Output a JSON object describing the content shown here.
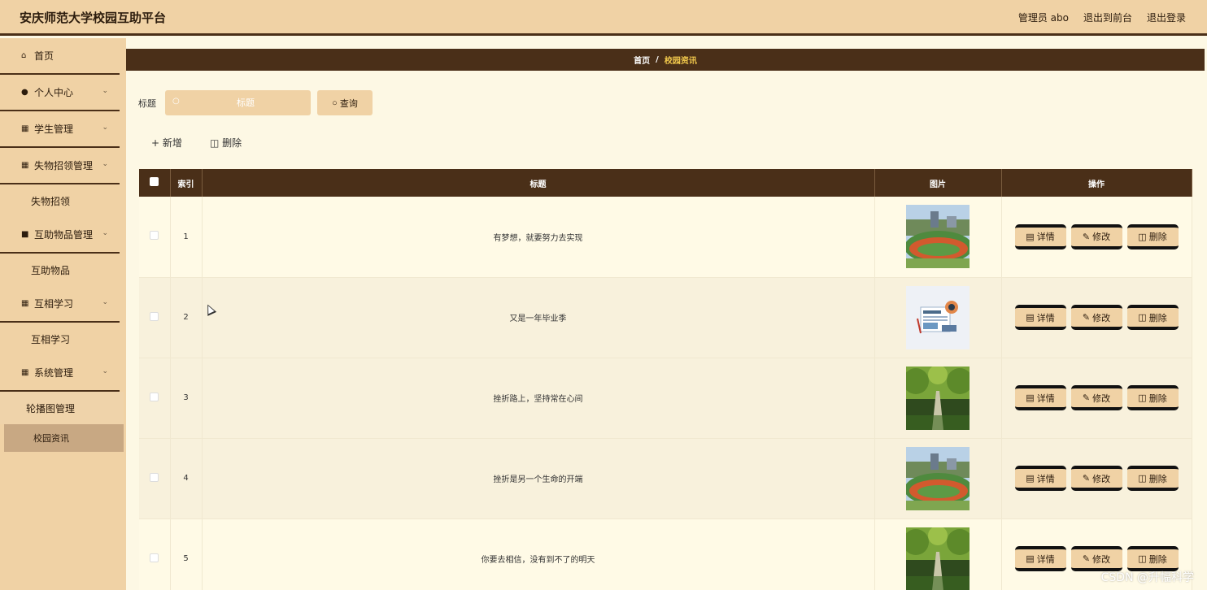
{
  "header": {
    "title": "安庆师范大学校园互助平台",
    "links": [
      "管理员 abo",
      "退出到前台",
      "退出登录"
    ]
  },
  "sidebar": {
    "items": [
      {
        "label": "首页",
        "icon": "home-icon",
        "chevron": false
      },
      {
        "label": "个人中心",
        "icon": "user-icon",
        "chevron": true
      },
      {
        "label": "学生管理",
        "icon": "grid-icon",
        "chevron": true
      },
      {
        "label": "失物招领管理",
        "icon": "grid-icon",
        "chevron": true
      },
      {
        "label": "失物招领",
        "sub": true
      },
      {
        "label": "互助物品管理",
        "icon": "book-icon",
        "chevron": true
      },
      {
        "label": "互助物品",
        "sub": true
      },
      {
        "label": "互相学习",
        "icon": "grid-icon",
        "chevron": true
      },
      {
        "label": "互相学习",
        "sub": true
      },
      {
        "label": "系统管理",
        "icon": "grid-icon",
        "chevron": true
      },
      {
        "label": "轮播图管理",
        "sub": true
      },
      {
        "label": "校园资讯",
        "sub": true,
        "active": true
      }
    ]
  },
  "breadcrumb": {
    "home": "首页",
    "sep": "/",
    "current": "校园资讯"
  },
  "search": {
    "label": "标题",
    "placeholder": "标题",
    "button": "查询"
  },
  "actions": {
    "add": "新增",
    "delete": "删除"
  },
  "table": {
    "headers": [
      "索引",
      "标题",
      "图片",
      "操作"
    ],
    "rows": [
      {
        "index": "1",
        "title": "有梦想，就要努力去实现",
        "image": "campus-track"
      },
      {
        "index": "2",
        "title": "又是一年毕业季",
        "image": "news-illustration"
      },
      {
        "index": "3",
        "title": "挫折路上，坚持常在心间",
        "image": "tree-road"
      },
      {
        "index": "4",
        "title": "挫折是另一个生命的开端",
        "image": "campus-track"
      },
      {
        "index": "5",
        "title": "你要去相信，没有到不了的明天",
        "image": "tree-road"
      }
    ],
    "ops": [
      "详情",
      "修改",
      "删除"
    ]
  },
  "watermark": "CSDN @升幅科学",
  "colors": {
    "accent": "#f0d2a5",
    "dark": "#4a2f18",
    "background": "#fdf8e4",
    "highlight": "#f2c94c"
  }
}
